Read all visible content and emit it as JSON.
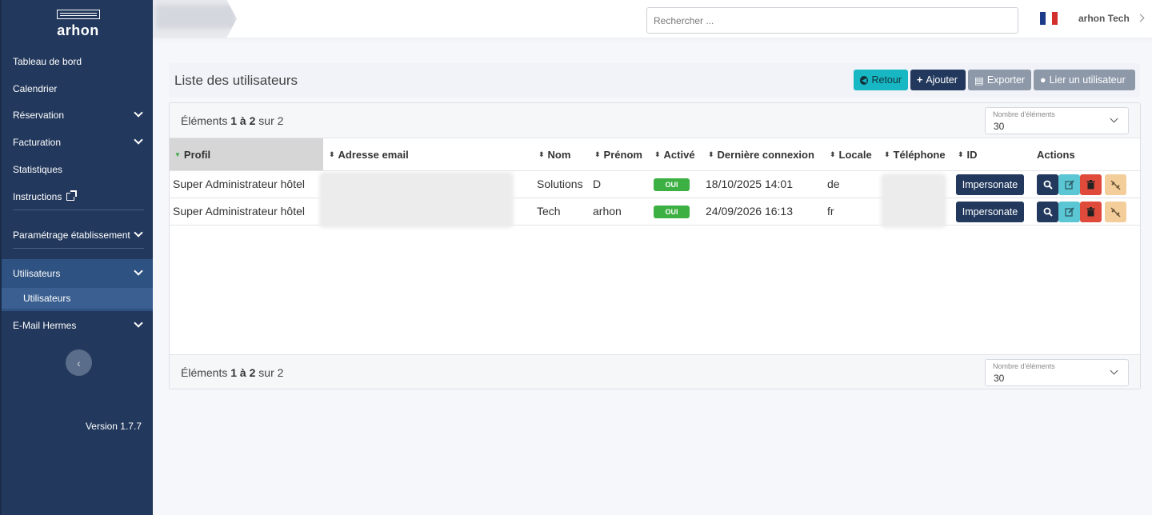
{
  "app": {
    "logo_text": "arhon"
  },
  "sidebar": {
    "items": [
      {
        "label": "Tableau de bord"
      },
      {
        "label": "Calendrier"
      },
      {
        "label": "Réservation"
      },
      {
        "label": "Facturation"
      },
      {
        "label": "Statistiques"
      },
      {
        "label": "Instructions"
      },
      {
        "label": "Paramétrage établissement"
      },
      {
        "label": "Utilisateurs"
      },
      {
        "label": "Utilisateurs"
      },
      {
        "label": "E-Mail Hermes"
      }
    ],
    "version": "Version 1.7.7"
  },
  "topbar": {
    "search_placeholder": "Rechercher ...",
    "user_name": "arhon Tech",
    "flag_colors": [
      "#1d3a8a",
      "#ffffff",
      "#d32f2f"
    ]
  },
  "page": {
    "title": "Liste des utilisateurs",
    "buttons": {
      "retour": "Retour",
      "ajouter": "Ajouter",
      "exporter": "Exporter",
      "lier": "Lier un utilisateur"
    }
  },
  "table": {
    "count_prefix": "Éléments",
    "count_range": "1 à 2",
    "count_suffix": "sur 2",
    "page_size_label": "Nombre d'éléments",
    "page_size_value": "30",
    "columns": {
      "profil": "Profil",
      "email": "Adresse email",
      "nom": "Nom",
      "prenom": "Prénom",
      "active": "Activé",
      "derniere": "Dernière connexion",
      "locale": "Locale",
      "telephone": "Téléphone",
      "id": "ID",
      "actions": "Actions"
    },
    "rows": [
      {
        "profil": "Super Administrateur hôtel",
        "nom": "Solutions",
        "prenom": "D",
        "active": "OUI",
        "derniere": "18/10/2025 14:01",
        "locale": "de",
        "impersonate": "Impersonate"
      },
      {
        "profil": "Super Administrateur hôtel",
        "nom": "Tech",
        "prenom": "arhon",
        "active": "OUI",
        "derniere": "24/09/2026 16:13",
        "locale": "fr",
        "impersonate": "Impersonate"
      }
    ]
  }
}
